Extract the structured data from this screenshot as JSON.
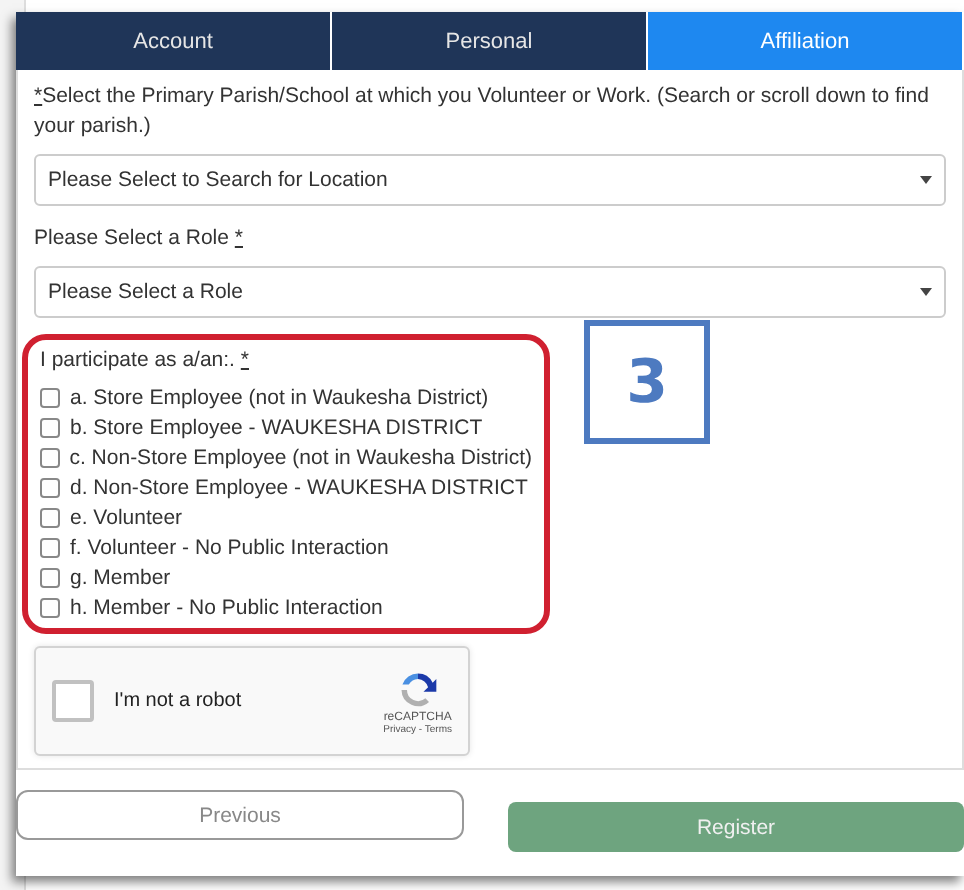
{
  "tabs": [
    {
      "label": "Account",
      "selected": false
    },
    {
      "label": "Personal",
      "selected": false
    },
    {
      "label": "Affiliation",
      "selected": true
    }
  ],
  "location": {
    "label_mark": "*",
    "label": "Select the Primary Parish/School at which you Volunteer or Work. (Search or scroll down to find your parish.)",
    "placeholder": "Please Select to Search for Location"
  },
  "role": {
    "label": "Please Select a Role",
    "required_mark": "*",
    "placeholder": "Please Select a Role"
  },
  "participation": {
    "label": "I participate as a/an:.",
    "required_mark": "*",
    "options": [
      {
        "label": "a. Store Employee (not in Waukesha District)",
        "checked": false
      },
      {
        "label": "b. Store Employee - WAUKESHA DISTRICT",
        "checked": false
      },
      {
        "label": "c. Non-Store Employee (not in Waukesha District)",
        "checked": false
      },
      {
        "label": "d. Non-Store Employee - WAUKESHA DISTRICT",
        "checked": false
      },
      {
        "label": "e. Volunteer",
        "checked": false
      },
      {
        "label": "f. Volunteer - No Public Interaction",
        "checked": false
      },
      {
        "label": "g. Member",
        "checked": false
      },
      {
        "label": "h. Member - No Public Interaction",
        "checked": false
      }
    ]
  },
  "captcha": {
    "label": "I'm not a robot",
    "checked": false,
    "brand": "reCAPTCHA",
    "links": "Privacy - Terms"
  },
  "buttons": {
    "previous": "Previous",
    "register": "Register"
  },
  "callout": "3"
}
